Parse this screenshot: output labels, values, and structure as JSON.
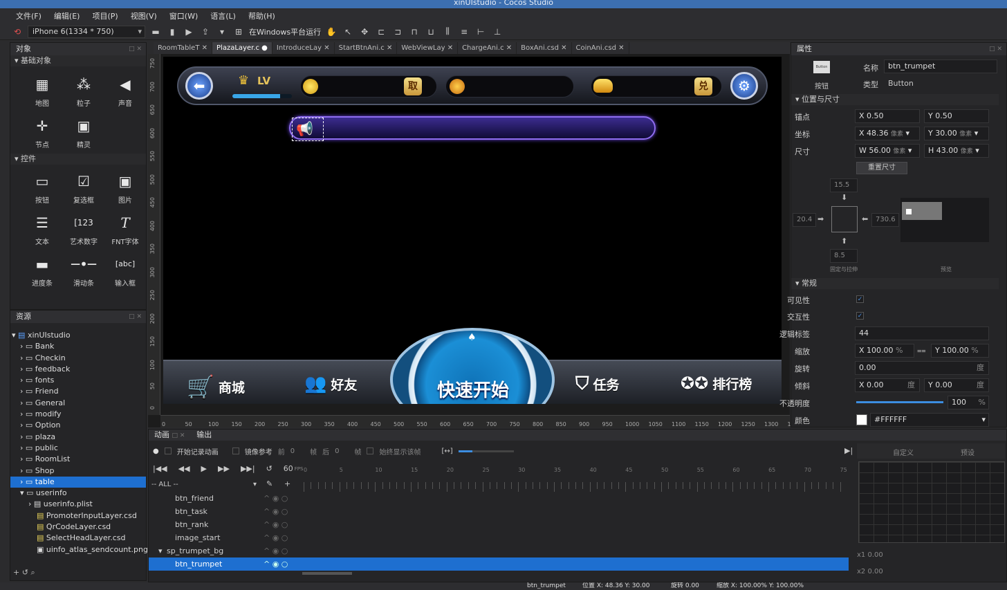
{
  "window": {
    "title": "xinUIstudio - Cocos Studio"
  },
  "menu": [
    "文件(F)",
    "编辑(E)",
    "项目(P)",
    "视图(V)",
    "窗口(W)",
    "语言(L)",
    "帮助(H)"
  ],
  "toolbar": {
    "device": "iPhone 6(1334 * 750)",
    "run_label": "在Windows平台运行"
  },
  "objects_panel": {
    "title": "对象",
    "basic_section": "基础对象",
    "basic": [
      "地图",
      "粒子",
      "声音",
      "节点",
      "精灵"
    ],
    "controls_section": "控件",
    "controls": [
      "按钮",
      "复选框",
      "图片",
      "文本",
      "艺术数字",
      "FNT字体",
      "进度条",
      "滑动条",
      "输入框"
    ]
  },
  "resources_panel": {
    "title": "资源",
    "root": "xinUIstudio",
    "folders": [
      "Bank",
      "Checkin",
      "feedback",
      "fonts",
      "Friend",
      "General",
      "modify",
      "Option",
      "plaza",
      "public",
      "RoomList",
      "Shop",
      "table",
      "userinfo"
    ],
    "selected_folder": "table",
    "children": [
      "userinfo.plist",
      "PromoterInputLayer.csd",
      "QrCodeLayer.csd",
      "SelectHeadLayer.csd",
      "uinfo_atlas_sendcount.png"
    ]
  },
  "tabs": [
    "RoomTableT",
    "PlazaLayer.c",
    "IntroduceLay",
    "StartBtnAni.c",
    "WebViewLay",
    "ChargeAni.c",
    "BoxAni.csd",
    "CoinAni.csd"
  ],
  "active_tab": "PlazaLayer.c",
  "game": {
    "lv": "LV",
    "btn_take": "取",
    "btn_exchange": "兑",
    "quick_start": "快速开始",
    "bottom": [
      "商城",
      "好友",
      "任务",
      "排行榜"
    ]
  },
  "ruler": {
    "v": [
      "750",
      "700",
      "650",
      "600",
      "550",
      "500",
      "450",
      "400",
      "350",
      "300",
      "250",
      "200",
      "150",
      "100",
      "50",
      "0"
    ],
    "h": [
      "0",
      "50",
      "100",
      "150",
      "200",
      "250",
      "300",
      "350",
      "400",
      "450",
      "500",
      "550",
      "600",
      "650",
      "700",
      "750",
      "800",
      "850",
      "900",
      "950",
      "1000",
      "1050",
      "1100",
      "1150",
      "1200",
      "1250",
      "1300",
      "13"
    ]
  },
  "properties": {
    "title": "属性",
    "widget_icon_label": "Button",
    "type_caption": "按钮",
    "name_label": "名称",
    "name": "btn_trumpet",
    "class_label": "类型",
    "class": "Button",
    "pos_section": "位置与尺寸",
    "anchor_label": "锚点",
    "anchor_x": "X 0.50",
    "anchor_y": "Y 0.50",
    "pos_label": "坐标",
    "pos_x": "X 48.36",
    "pos_y": "Y 30.00",
    "unit": "像素",
    "size_label": "尺寸",
    "size_w": "W 56.00",
    "size_h": "H 43.00",
    "reset_size": "重置尺寸",
    "margin_top": "15.5",
    "margin_left": "20.4",
    "margin_right": "730.6",
    "margin_bottom": "8.5",
    "layout_caption": "固定与拉伸",
    "preview_caption": "预览",
    "general_section": "常规",
    "visible_label": "可见性",
    "interactive_label": "交互性",
    "tag_label": "逻辑标签",
    "tag": "44",
    "scale_label": "缩放",
    "scale_x": "X 100.00",
    "scale_y": "Y 100.00",
    "percent": "%",
    "rotation_label": "旋转",
    "rotation": "0.00",
    "deg": "度",
    "skew_label": "倾斜",
    "skew_x": "X 0.00",
    "skew_y": "Y 0.00",
    "opacity_label": "不透明度",
    "opacity": "100",
    "opacity_fraction": 1.0,
    "color_label": "颜色",
    "color": "#FFFFFF"
  },
  "animation": {
    "tab_anim": "动画",
    "tab_output": "输出",
    "record": "开始记录动画",
    "onion": "镜像参考",
    "prev_label": "前",
    "prev": "0",
    "frame1": "帧",
    "next_label": "后",
    "next": "0",
    "frame2": "帧",
    "always_show": "始终显示该帧",
    "fps": "60",
    "fps_unit": "FPS",
    "filter": "-- ALL --",
    "layers": [
      "btn_friend",
      "btn_task",
      "btn_rank",
      "image_start",
      "sp_trumpet_bg",
      "btn_trumpet"
    ],
    "frames": [
      "0",
      "5",
      "10",
      "15",
      "20",
      "25",
      "30",
      "35",
      "40",
      "45",
      "50",
      "55",
      "60",
      "65",
      "70",
      "75"
    ],
    "curve_tabs": [
      "自定义",
      "预设"
    ],
    "x1": "x1  0.00",
    "x2": "x2  0.00"
  },
  "status": {
    "name": "btn_trumpet",
    "pos": "位置 X: 48.36  Y: 30.00",
    "rot": "旋转 0.00",
    "scale": "缩放 X: 100.00%  Y: 100.00%"
  }
}
